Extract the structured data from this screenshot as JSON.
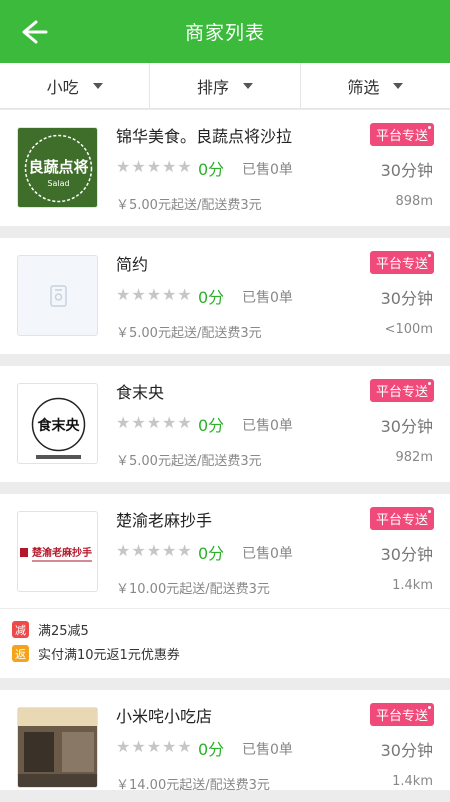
{
  "header": {
    "title": "商家列表",
    "back_icon": "arrow-left-icon"
  },
  "filters": [
    {
      "label": "小吃"
    },
    {
      "label": "排序"
    },
    {
      "label": "筛选"
    }
  ],
  "colors": {
    "brand_green": "#3cba3c",
    "badge_pink": "#ef4a7a",
    "score_green": "#2bb12b"
  },
  "stores": [
    {
      "name": "锦华美食。良蔬点将沙拉",
      "badge": "平台专送",
      "score": "0分",
      "sold": "已售0单",
      "eta": "30分钟",
      "min_order": "￥5.00元起送/配送费3元",
      "distance": "898m",
      "logo_text": "良蔬点将",
      "logo_sub": "Salad"
    },
    {
      "name": "简约",
      "badge": "平台专送",
      "score": "0分",
      "sold": "已售0单",
      "eta": "30分钟",
      "min_order": "￥5.00元起送/配送费3元",
      "distance": "<100m"
    },
    {
      "name": "食末央",
      "badge": "平台专送",
      "score": "0分",
      "sold": "已售0单",
      "eta": "30分钟",
      "min_order": "￥5.00元起送/配送费3元",
      "distance": "982m",
      "logo_text": "食末央"
    },
    {
      "name": "楚渝老麻抄手",
      "badge": "平台专送",
      "score": "0分",
      "sold": "已售0单",
      "eta": "30分钟",
      "min_order": "￥10.00元起送/配送费3元",
      "distance": "1.4km",
      "logo_text": "楚渝老麻抄手",
      "promos": [
        {
          "tag": "减",
          "text": "满25减5",
          "color": "#ef4a4a"
        },
        {
          "tag": "返",
          "text": "实付满10元返1元优惠券",
          "color": "#f3a41c"
        }
      ]
    },
    {
      "name": "小米咤小吃店",
      "badge": "平台专送",
      "score": "0分",
      "sold": "已售0单",
      "eta": "30分钟",
      "min_order": "￥14.00元起送/配送费3元",
      "distance": "1.4km"
    }
  ]
}
